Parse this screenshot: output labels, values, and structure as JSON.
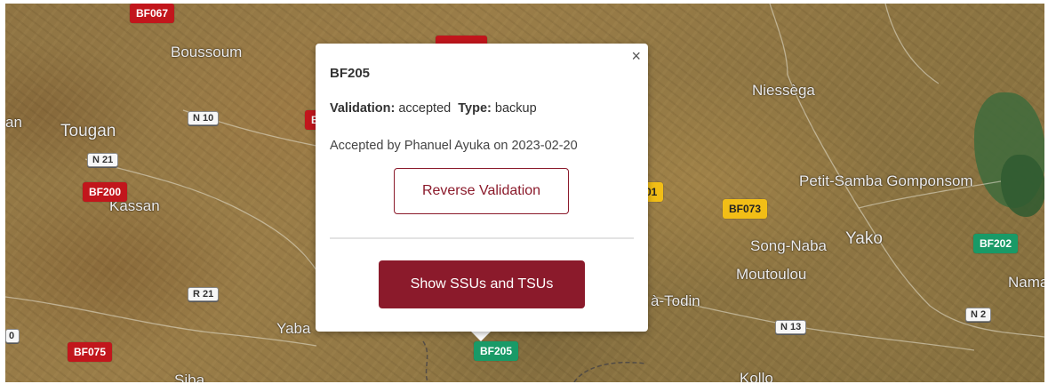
{
  "map": {
    "places": [
      {
        "id": "boussoum",
        "label": "Boussoum"
      },
      {
        "id": "tougan",
        "label": "Tougan"
      },
      {
        "id": "kassan",
        "label": "Kassan"
      },
      {
        "id": "yaba",
        "label": "Yaba"
      },
      {
        "id": "niessega",
        "label": "Niessèga"
      },
      {
        "id": "petit-samba",
        "label": "Petit-Samba Gomponsom"
      },
      {
        "id": "yako",
        "label": "Yako"
      },
      {
        "id": "song-naba",
        "label": "Song-Naba"
      },
      {
        "id": "moutoulou",
        "label": "Moutoulou"
      },
      {
        "id": "todin",
        "label": "à-Todin"
      },
      {
        "id": "kollo",
        "label": "Kollo"
      },
      {
        "id": "nama",
        "label": "Nama"
      },
      {
        "id": "edge-left",
        "label": "an"
      },
      {
        "id": "siba",
        "label": "Siba"
      }
    ],
    "road_shields": [
      {
        "id": "n10",
        "label": "N 10"
      },
      {
        "id": "n21",
        "label": "N 21"
      },
      {
        "id": "r21",
        "label": "R 21"
      },
      {
        "id": "n13",
        "label": "N 13"
      },
      {
        "id": "n2",
        "label": "N 2"
      },
      {
        "id": "edge",
        "label": "0"
      }
    ],
    "markers": [
      {
        "id": "BF067",
        "label": "BF067",
        "status": "red"
      },
      {
        "id": "BF200",
        "label": "BF200",
        "status": "red"
      },
      {
        "id": "BF075",
        "label": "BF075",
        "status": "red"
      },
      {
        "id": "BF205",
        "label": "BF205",
        "status": "green"
      },
      {
        "id": "BF073",
        "label": "BF073",
        "status": "yellow"
      },
      {
        "id": "BF202",
        "label": "BF202",
        "status": "green"
      },
      {
        "id": "partial-yellow",
        "label": "01",
        "status": "yellow"
      },
      {
        "id": "partial-red-1",
        "label": "B",
        "status": "red"
      }
    ]
  },
  "popup": {
    "title": "BF205",
    "validation_label": "Validation:",
    "validation_value": "accepted",
    "type_label": "Type:",
    "type_value": "backup",
    "accepted_text": "Accepted by Phanuel Ayuka on 2023-02-20",
    "reverse_button": "Reverse Validation",
    "show_button": "Show SSUs and TSUs",
    "close_symbol": "×"
  },
  "colors": {
    "accent": "#8b1a2b",
    "marker_red": "#c2161c",
    "marker_green": "#199a67",
    "marker_yellow": "#f2be16"
  }
}
